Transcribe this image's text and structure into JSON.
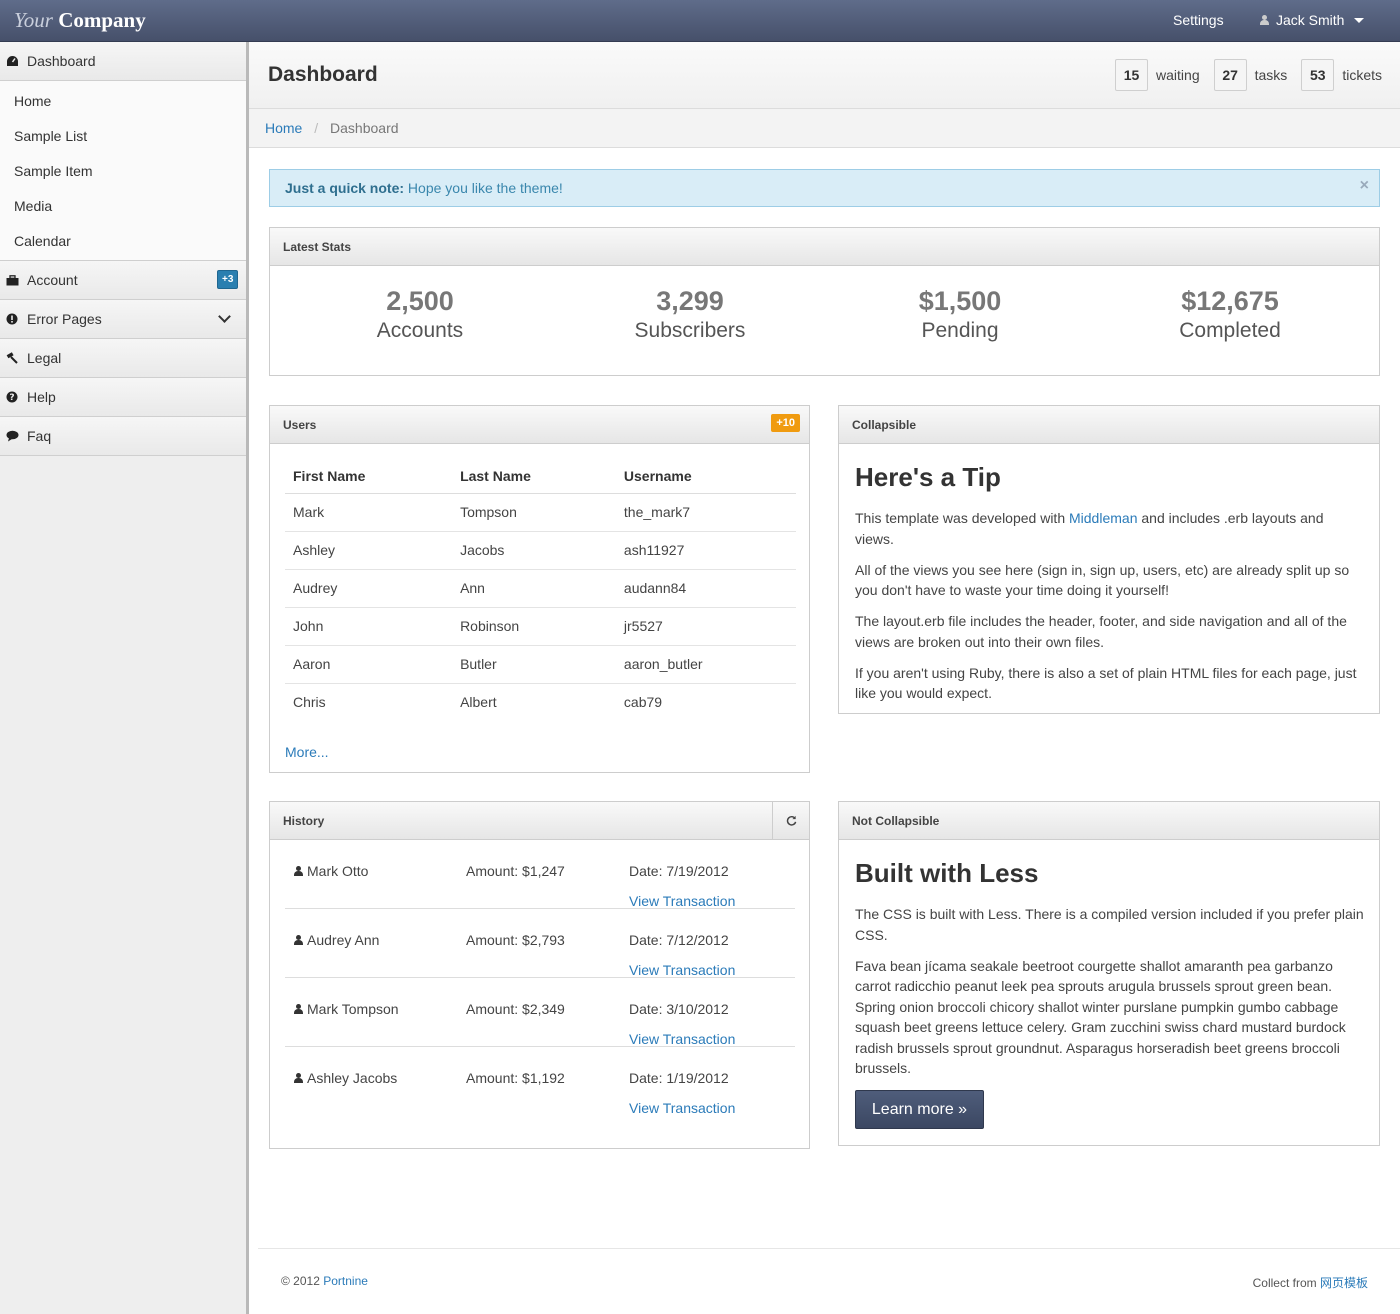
{
  "brand": {
    "part1": "Your",
    "part2": "Company"
  },
  "topnav": {
    "settings": "Settings",
    "user": "Jack Smith"
  },
  "sidebar": {
    "dashboard": "Dashboard",
    "sub_items": [
      "Home",
      "Sample List",
      "Sample Item",
      "Media",
      "Calendar"
    ],
    "account": "Account",
    "account_badge": "+3",
    "error_pages": "Error Pages",
    "legal": "Legal",
    "help": "Help",
    "faq": "Faq"
  },
  "header": {
    "title": "Dashboard",
    "counters": [
      {
        "value": "15",
        "label": "waiting"
      },
      {
        "value": "27",
        "label": "tasks"
      },
      {
        "value": "53",
        "label": "tickets"
      }
    ]
  },
  "breadcrumb": {
    "home": "Home",
    "current": "Dashboard"
  },
  "alert": {
    "strong": "Just a quick note:",
    "text": "Hope you like the theme!",
    "close": "×"
  },
  "stats": {
    "title": "Latest Stats",
    "items": [
      {
        "value": "2,500",
        "label": "Accounts"
      },
      {
        "value": "3,299",
        "label": "Subscribers"
      },
      {
        "value": "$1,500",
        "label": "Pending"
      },
      {
        "value": "$12,675",
        "label": "Completed"
      }
    ]
  },
  "users": {
    "title": "Users",
    "badge": "+10",
    "columns": [
      "First Name",
      "Last Name",
      "Username"
    ],
    "rows": [
      [
        "Mark",
        "Tompson",
        "the_mark7"
      ],
      [
        "Ashley",
        "Jacobs",
        "ash11927"
      ],
      [
        "Audrey",
        "Ann",
        "audann84"
      ],
      [
        "John",
        "Robinson",
        "jr5527"
      ],
      [
        "Aaron",
        "Butler",
        "aaron_butler"
      ],
      [
        "Chris",
        "Albert",
        "cab79"
      ]
    ],
    "more": "More..."
  },
  "collapsible": {
    "title": "Collapsible",
    "heading": "Here's a Tip",
    "p1_before": "This template was developed with ",
    "p1_link": "Middleman",
    "p1_after": " and includes .erb layouts and views.",
    "p2": "All of the views you see here (sign in, sign up, users, etc) are already split up so you don't have to waste your time doing it yourself!",
    "p3": "The layout.erb file includes the header, footer, and side navigation and all of the views are broken out into their own files.",
    "p4": "If you aren't using Ruby, there is also a set of plain HTML files for each page, just like you would expect."
  },
  "history": {
    "title": "History",
    "rows": [
      {
        "name": "Mark Otto",
        "amount": "Amount: $1,247",
        "date": "Date: 7/19/2012",
        "link": "View Transaction"
      },
      {
        "name": "Audrey Ann",
        "amount": "Amount: $2,793",
        "date": "Date: 7/12/2012",
        "link": "View Transaction"
      },
      {
        "name": "Mark Tompson",
        "amount": "Amount: $2,349",
        "date": "Date: 3/10/2012",
        "link": "View Transaction"
      },
      {
        "name": "Ashley Jacobs",
        "amount": "Amount: $1,192",
        "date": "Date: 1/19/2012",
        "link": "View Transaction"
      }
    ]
  },
  "not_collapsible": {
    "title": "Not Collapsible",
    "heading": "Built with Less",
    "p1": "The CSS is built with Less. There is a compiled version included if you prefer plain CSS.",
    "p2": "Fava bean jícama seakale beetroot courgette shallot amaranth pea garbanzo carrot radicchio peanut leek pea sprouts arugula brussels sprout green bean. Spring onion broccoli chicory shallot winter purslane pumpkin gumbo cabbage squash beet greens lettuce celery. Gram zucchini swiss chard mustard burdock radish brussels sprout groundnut. Asparagus horseradish beet greens broccoli brussels.",
    "button": "Learn more »"
  },
  "footer": {
    "copyright": "© 2012 ",
    "copyright_link": "Portnine",
    "collect": "Collect from ",
    "collect_link": "网页模板"
  }
}
